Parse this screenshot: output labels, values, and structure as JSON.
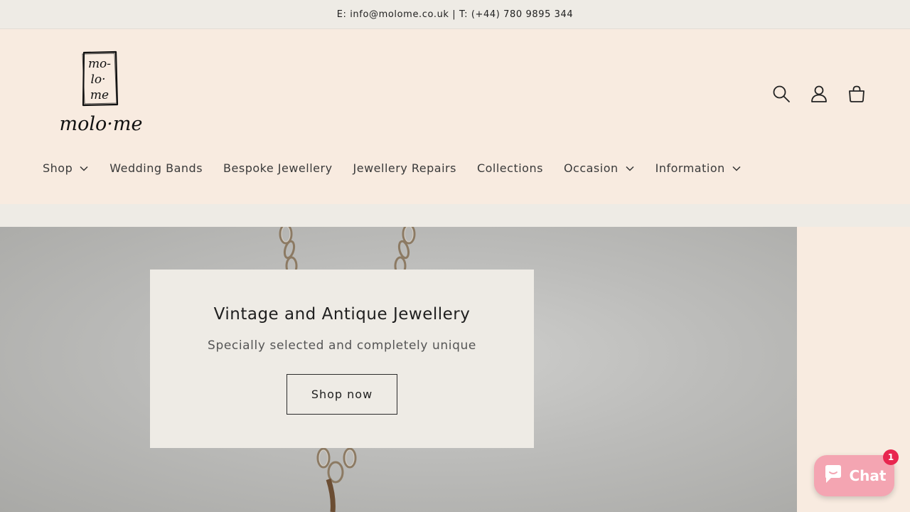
{
  "announcement": {
    "text": "E: info@molome.co.uk | T: (+44) 780 9895 344"
  },
  "header": {
    "logo_text_top": [
      "mo-",
      "lo·",
      "me"
    ],
    "logo_text_bottom": "molo·me",
    "icons": [
      "search-icon",
      "account-icon",
      "cart-icon"
    ]
  },
  "nav": {
    "items": [
      {
        "label": "Shop",
        "dropdown": true
      },
      {
        "label": "Wedding Bands",
        "dropdown": false
      },
      {
        "label": "Bespoke Jewellery",
        "dropdown": false
      },
      {
        "label": "Jewellery Repairs",
        "dropdown": false
      },
      {
        "label": "Collections",
        "dropdown": false
      },
      {
        "label": "Occasion",
        "dropdown": true
      },
      {
        "label": "Information",
        "dropdown": true
      }
    ]
  },
  "hero": {
    "title": "Vintage and Antique Jewellery",
    "subtitle": "Specially selected and completely unique",
    "button_label": "Shop now"
  },
  "chat": {
    "label": "Chat",
    "badge_count": "1"
  },
  "colors": {
    "header_bg": "#f8ebe0",
    "announcement_bg": "#eeebe5",
    "chat_bg": "#f4a5b2",
    "badge_bg": "#e8264f"
  }
}
